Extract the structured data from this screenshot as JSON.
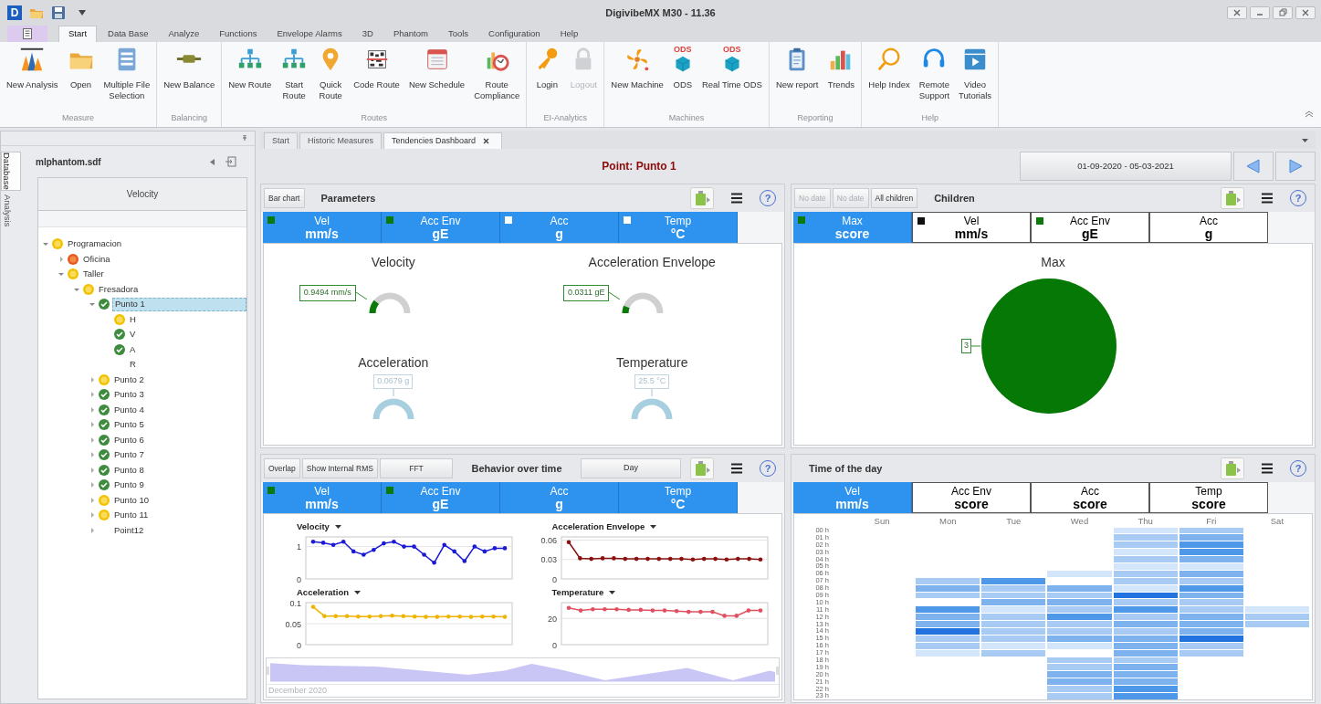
{
  "window": {
    "logo": "D",
    "title": "DigivibeMX M30 - 11.36"
  },
  "menu_tabs": [
    {
      "label": "Start",
      "selected": true
    },
    {
      "label": "Data Base",
      "selected": false
    },
    {
      "label": "Analyze",
      "selected": false
    },
    {
      "label": "Functions",
      "selected": false
    },
    {
      "label": "Envelope Alarms",
      "selected": false
    },
    {
      "label": "3D",
      "selected": false
    },
    {
      "label": "Phantom",
      "selected": false
    },
    {
      "label": "Tools",
      "selected": false
    },
    {
      "label": "Configuration",
      "selected": false
    },
    {
      "label": "Help",
      "selected": false
    }
  ],
  "ribbon": {
    "groups": [
      {
        "label": "Measure",
        "buttons": [
          {
            "label": "New Analysis",
            "disabled": false
          },
          {
            "label": "Open",
            "disabled": false
          },
          {
            "label": "Multiple File\nSelection",
            "disabled": false
          }
        ]
      },
      {
        "label": "Balancing",
        "buttons": [
          {
            "label": "New Balance",
            "disabled": false
          }
        ]
      },
      {
        "label": "Routes",
        "buttons": [
          {
            "label": "New Route",
            "disabled": false
          },
          {
            "label": "Start\nRoute",
            "disabled": false
          },
          {
            "label": "Quick\nRoute",
            "disabled": false
          },
          {
            "label": "Code Route",
            "disabled": false
          },
          {
            "label": "New Schedule",
            "disabled": false
          },
          {
            "label": "Route\nCompliance",
            "disabled": false
          }
        ]
      },
      {
        "label": "EI-Analytics",
        "buttons": [
          {
            "label": "Login",
            "disabled": false
          },
          {
            "label": "Logout",
            "disabled": true
          }
        ]
      },
      {
        "label": "Machines",
        "buttons": [
          {
            "label": "New Machine",
            "disabled": false
          },
          {
            "label": "ODS",
            "icon_text": "ODS",
            "disabled": false
          },
          {
            "label": "Real Time ODS",
            "icon_text": "ODS",
            "disabled": false
          }
        ]
      },
      {
        "label": "Reporting",
        "buttons": [
          {
            "label": "New report",
            "disabled": false
          },
          {
            "label": "Trends",
            "disabled": false
          }
        ]
      },
      {
        "label": "Help",
        "buttons": [
          {
            "label": "Help Index",
            "disabled": false
          },
          {
            "label": "Remote\nSupport",
            "disabled": false
          },
          {
            "label": "Video\nTutorials",
            "disabled": false
          }
        ]
      }
    ]
  },
  "left_panel": {
    "side_tabs": [
      {
        "label": "Database",
        "selected": true
      },
      {
        "label": "Analysis",
        "selected": false
      }
    ],
    "file": "mlphantom.sdf",
    "column_header": "Velocity",
    "tree": [
      {
        "label": "Programacion",
        "kind": "warning",
        "expanded": true,
        "selected": false,
        "children": [
          {
            "label": "Oficina",
            "kind": "alarm",
            "expanded": false,
            "selected": false
          },
          {
            "label": "Taller",
            "kind": "warning",
            "expanded": true,
            "selected": false,
            "children": [
              {
                "label": "Fresadora",
                "kind": "warning",
                "expanded": true,
                "selected": false,
                "children": [
                  {
                    "label": "Punto 1",
                    "kind": "ok",
                    "expanded": true,
                    "selected": true,
                    "children": [
                      {
                        "label": "H",
                        "kind": "warning",
                        "selected": false
                      },
                      {
                        "label": "V",
                        "kind": "ok",
                        "selected": false
                      },
                      {
                        "label": "A",
                        "kind": "ok",
                        "selected": false
                      },
                      {
                        "label": "R",
                        "kind": "plain",
                        "selected": false
                      }
                    ]
                  },
                  {
                    "label": "Punto 2",
                    "kind": "warning",
                    "expanded": false,
                    "selected": false
                  },
                  {
                    "label": "Punto 3",
                    "kind": "ok",
                    "expanded": false,
                    "selected": false
                  },
                  {
                    "label": "Punto 4",
                    "kind": "ok",
                    "expanded": false,
                    "selected": false
                  },
                  {
                    "label": "Punto 5",
                    "kind": "ok",
                    "expanded": false,
                    "selected": false
                  },
                  {
                    "label": "Punto 6",
                    "kind": "ok",
                    "expanded": false,
                    "selected": false
                  },
                  {
                    "label": "Punto 7",
                    "kind": "ok",
                    "expanded": false,
                    "selected": false
                  },
                  {
                    "label": "Punto 8",
                    "kind": "ok",
                    "expanded": false,
                    "selected": false
                  },
                  {
                    "label": "Punto 9",
                    "kind": "ok",
                    "expanded": false,
                    "selected": false
                  },
                  {
                    "label": "Punto 10",
                    "kind": "warning",
                    "expanded": false,
                    "selected": false
                  },
                  {
                    "label": "Punto 11",
                    "kind": "warning",
                    "expanded": false,
                    "selected": false
                  },
                  {
                    "label": "Point12",
                    "kind": "plain",
                    "expanded": false,
                    "selected": false
                  }
                ]
              }
            ]
          }
        ]
      }
    ]
  },
  "doc_tabs": [
    {
      "label": "Start",
      "selected": false
    },
    {
      "label": "Historic Measures",
      "selected": false
    },
    {
      "label": "Tendencies Dashboard",
      "selected": true
    }
  ],
  "header": {
    "point": "Point: Punto 1",
    "date_range": "01-09-2020 - 05-03-2021"
  },
  "panels": [
    {
      "kind": "gauges",
      "buttons": [
        {
          "label": "Bar chart"
        }
      ],
      "title": "Parameters",
      "help": "?",
      "tabs": [
        {
          "name": "Vel",
          "unit": "mm/s",
          "selected": true,
          "color": "#0b7a0b"
        },
        {
          "name": "Acc Env",
          "unit": "gE",
          "selected": true,
          "color": "#0b7a0b"
        },
        {
          "name": "Acc",
          "unit": "g",
          "selected": true,
          "color": "#ffffff"
        },
        {
          "name": "Temp",
          "unit": "°C",
          "selected": true,
          "color": "#ffffff"
        }
      ],
      "gauges": [
        {
          "title": "Velocity",
          "reading": "0.9494 mm/s",
          "enabled": true,
          "level": 0.22
        },
        {
          "title": "Acceleration Envelope",
          "reading": "0.0311 gE",
          "enabled": true,
          "level": 0.12
        },
        {
          "title": "Acceleration",
          "reading": "0.0679 g",
          "enabled": false
        },
        {
          "title": "Temperature",
          "reading": "25.5 °C",
          "enabled": false
        }
      ]
    },
    {
      "kind": "pie",
      "buttons": [
        {
          "label": "No date",
          "disabled": true
        },
        {
          "label": "No date",
          "disabled": true
        },
        {
          "label": "All children",
          "disabled": false
        }
      ],
      "title": "Children",
      "help": "?",
      "tabs": [
        {
          "name": "Max",
          "unit": "score",
          "selected": true,
          "color": "#0b7a0b"
        },
        {
          "name": "Vel",
          "unit": "mm/s",
          "selected": false,
          "color": "#111111"
        },
        {
          "name": "Acc Env",
          "unit": "gE",
          "selected": false,
          "color": "#0b7a0b"
        },
        {
          "name": "Acc",
          "unit": "g",
          "selected": false
        }
      ],
      "chart_data": {
        "type": "pie",
        "title": "Max",
        "series": [
          {
            "color": "#067806",
            "values": [
              3
            ]
          }
        ],
        "data_labels": true
      }
    },
    {
      "kind": "lines",
      "buttons": [
        {
          "label": "Overlap"
        },
        {
          "label": "Show Internal RMS"
        },
        {
          "label": "FFT"
        }
      ],
      "title": "Behavior over time",
      "range_button": "Day",
      "help": "?",
      "tabs": [
        {
          "name": "Vel",
          "unit": "mm/s",
          "selected": true,
          "color": "#0b7a0b"
        },
        {
          "name": "Acc Env",
          "unit": "gE",
          "selected": true,
          "color": "#0b7a0b"
        },
        {
          "name": "Acc",
          "unit": "g",
          "selected": true
        },
        {
          "name": "Temp",
          "unit": "°C",
          "selected": true
        }
      ],
      "charts": [
        {
          "chart_data": {
            "type": "line",
            "title": "Velocity",
            "ylim": [
              0,
              1.3
            ],
            "yticks": [
              0,
              1
            ],
            "series": [
              {
                "color": "#1a1ad6",
                "values": [
                  1.15,
                  1.12,
                  1.05,
                  1.15,
                  0.85,
                  0.75,
                  0.9,
                  1.1,
                  1.15,
                  1.0,
                  1.0,
                  0.75,
                  0.5,
                  1.05,
                  0.85,
                  0.55,
                  1.0,
                  0.85,
                  0.95,
                  0.95
                ]
              }
            ]
          }
        },
        {
          "chart_data": {
            "type": "line",
            "title": "Acceleration Envelope",
            "ylim": [
              0,
              0.065
            ],
            "yticks": [
              0,
              0.03,
              0.06
            ],
            "series": [
              {
                "color": "#8b1010",
                "values": [
                  0.057,
                  0.032,
                  0.031,
                  0.032,
                  0.032,
                  0.031,
                  0.031,
                  0.031,
                  0.031,
                  0.031,
                  0.031,
                  0.03,
                  0.031,
                  0.031,
                  0.03,
                  0.031,
                  0.031,
                  0.03
                ]
              }
            ]
          }
        },
        {
          "chart_data": {
            "type": "line",
            "title": "Acceleration",
            "ylim": [
              0,
              0.1
            ],
            "yticks": [
              0,
              0.05,
              0.1
            ],
            "series": [
              {
                "color": "#f0b400",
                "values": [
                  0.09,
                  0.068,
                  0.068,
                  0.068,
                  0.067,
                  0.067,
                  0.068,
                  0.069,
                  0.068,
                  0.067,
                  0.066,
                  0.066,
                  0.067,
                  0.067,
                  0.066,
                  0.067,
                  0.067,
                  0.066
                ]
              }
            ]
          }
        },
        {
          "chart_data": {
            "type": "line",
            "title": "Temperature",
            "ylim": [
              0,
              32
            ],
            "yticks": [
              0,
              20
            ],
            "series": [
              {
                "color": "#e05060",
                "values": [
                  28,
                  26,
                  27,
                  27,
                  27,
                  26.5,
                  26.5,
                  26,
                  26,
                  25.5,
                  25,
                  25,
                  25,
                  22,
                  22,
                  26,
                  26
                ]
              }
            ]
          }
        }
      ],
      "navigator_label": "December 2020"
    },
    {
      "kind": "heatmap",
      "title": "Time of the day",
      "help": "?",
      "tabs": [
        {
          "name": "Vel",
          "unit": "mm/s",
          "selected": true
        },
        {
          "name": "Acc Env",
          "unit": "score",
          "selected": false
        },
        {
          "name": "Acc",
          "unit": "score",
          "selected": false
        },
        {
          "name": "Temp",
          "unit": "score",
          "selected": false
        }
      ],
      "days": [
        "Sun",
        "Mon",
        "Tue",
        "Wed",
        "Thu",
        "Fri",
        "Sat"
      ],
      "hours": [
        "00 h",
        "01 h",
        "02 h",
        "03 h",
        "04 h",
        "05 h",
        "06 h",
        "07 h",
        "08 h",
        "09 h",
        "10 h",
        "11 h",
        "12 h",
        "13 h",
        "14 h",
        "15 h",
        "16 h",
        "17 h",
        "18 h",
        "19 h",
        "20 h",
        "21 h",
        "22 h",
        "23 h"
      ]
    }
  ]
}
